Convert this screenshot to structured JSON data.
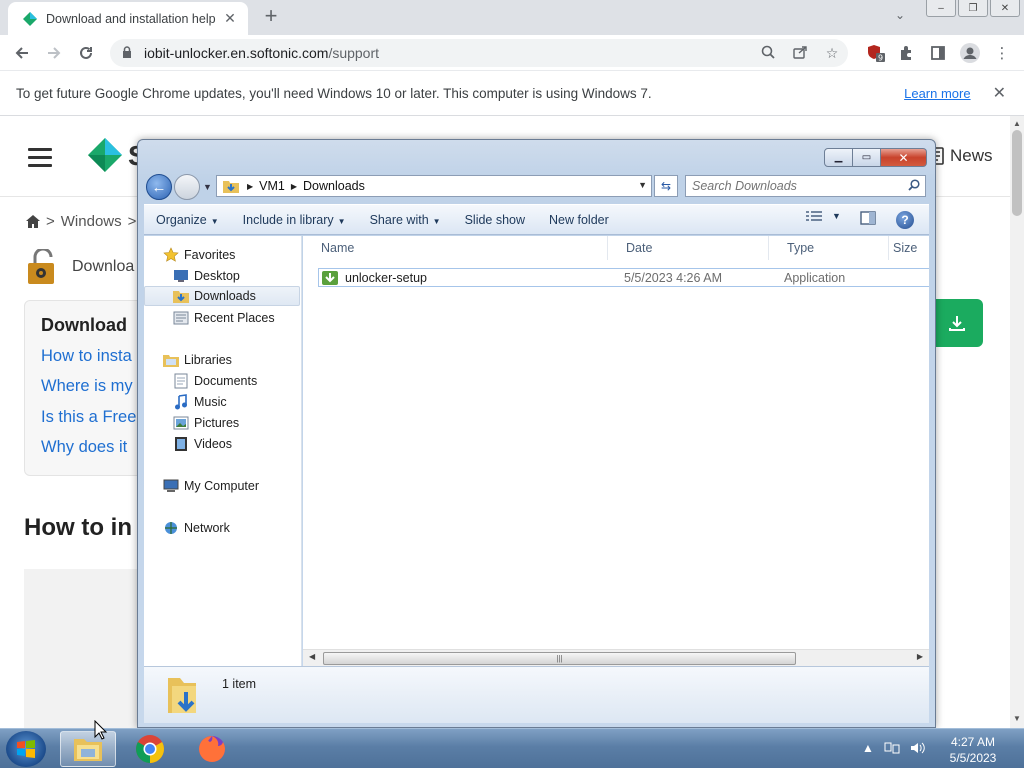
{
  "chrome": {
    "tab_title": "Download and installation help",
    "url_host": "iobit-unlocker.en.softonic.com",
    "url_path": "/support",
    "extension_badge": "9",
    "infobar_message": "To get future Google Chrome updates, you'll need Windows 10 or later. This computer is using Windows 7.",
    "infobar_link": "Learn more"
  },
  "page": {
    "logo_letter": "S",
    "news_label": "News",
    "breadcrumb": [
      "Windows",
      ">"
    ],
    "download_title": "Downloa",
    "card_title": "Download",
    "card_links": [
      "How to insta",
      "Where is my",
      "Is this a Free",
      "Why does it"
    ],
    "howto_heading": "How to in"
  },
  "explorer": {
    "address_segments": [
      "VM1",
      "Downloads"
    ],
    "search_placeholder": "Search Downloads",
    "commands": [
      "Organize",
      "Include in library",
      "Share with",
      "Slide show",
      "New folder"
    ],
    "nav": {
      "favorites": "Favorites",
      "desktop": "Desktop",
      "downloads": "Downloads",
      "recent": "Recent Places",
      "libraries": "Libraries",
      "documents": "Documents",
      "music": "Music",
      "pictures": "Pictures",
      "videos": "Videos",
      "computer": "My Computer",
      "network": "Network"
    },
    "columns": [
      "Name",
      "Date",
      "Type",
      "Size"
    ],
    "files": [
      {
        "name": "unlocker-setup",
        "date": "5/5/2023 4:26 AM",
        "type": "Application"
      }
    ],
    "item_count": "1 item"
  },
  "taskbar": {
    "time": "4:27 AM",
    "date": "5/5/2023"
  }
}
